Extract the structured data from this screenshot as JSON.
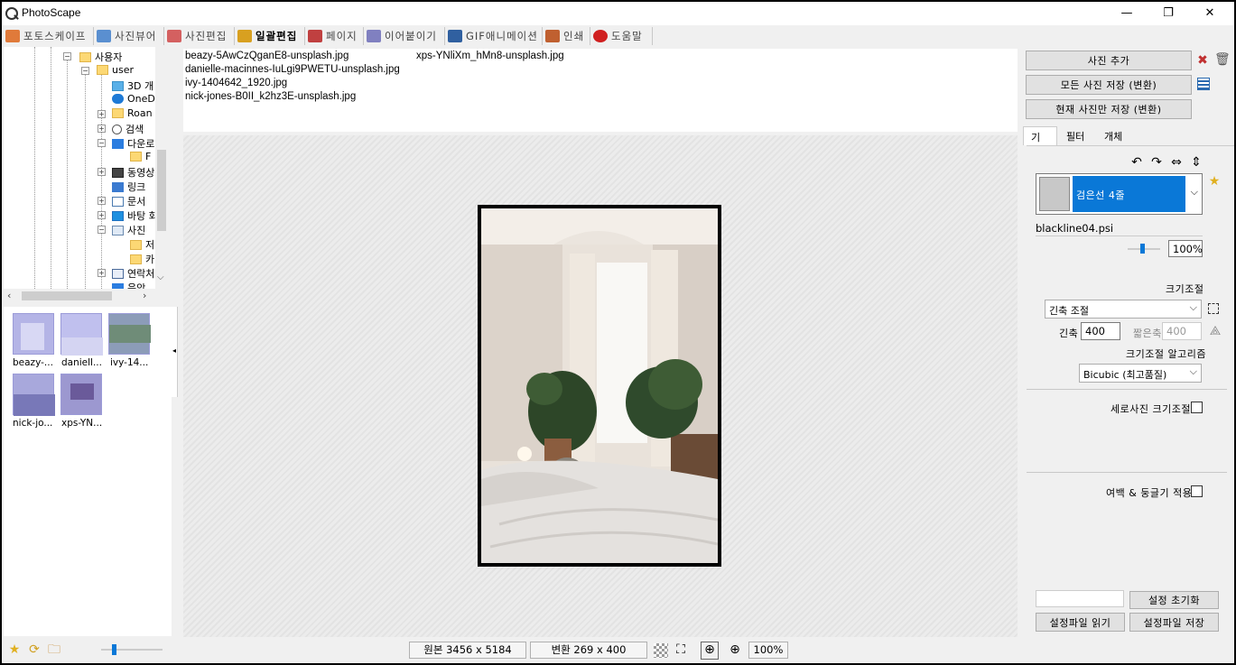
{
  "window": {
    "title": "PhotoScape",
    "minimize": "—",
    "maximize": "❐",
    "close": "✕"
  },
  "tabs": [
    {
      "label": "포토스케이프",
      "color": "#e07a3a"
    },
    {
      "label": "사진뷰어",
      "color": "#5a8fd0"
    },
    {
      "label": "사진편집",
      "color": "#d46060"
    },
    {
      "label": "일괄편집",
      "color": "#d8a020"
    },
    {
      "label": "페이지",
      "color": "#c04040"
    },
    {
      "label": "이어붙이기",
      "color": "#8080c0"
    },
    {
      "label": "GIF애니메이션",
      "color": "#3060a0"
    },
    {
      "label": "인쇄",
      "color": "#c06030"
    },
    {
      "label": "도움말",
      "color": "#d02020"
    }
  ],
  "tree": {
    "items": [
      {
        "label": "사용자"
      },
      {
        "label": "user"
      },
      {
        "label": "3D 개"
      },
      {
        "label": "OneD"
      },
      {
        "label": "Roan"
      },
      {
        "label": "검색"
      },
      {
        "label": "다운로"
      },
      {
        "label": "F"
      },
      {
        "label": "동영상"
      },
      {
        "label": "링크"
      },
      {
        "label": "문서"
      },
      {
        "label": "바탕 화"
      },
      {
        "label": "사진"
      },
      {
        "label": "저"
      },
      {
        "label": "카"
      },
      {
        "label": "연락처"
      },
      {
        "label": "음악"
      }
    ]
  },
  "thumbnails": [
    {
      "label": "beazy-...",
      "color": "#b4b4e6"
    },
    {
      "label": "daniell...",
      "color": "#c0c0ee"
    },
    {
      "label": "ivy-14...",
      "color": "#8c9cb8"
    },
    {
      "label": "nick-jo...",
      "color": "#a8a8dc"
    },
    {
      "label": "xps-YN...",
      "color": "#9c98d0"
    }
  ],
  "files": {
    "col1": [
      "beazy-5AwCzQganE8-unsplash.jpg",
      "danielle-macinnes-IuLgi9PWETU-unsplash.jpg",
      "ivy-1404642_1920.jpg",
      "nick-jones-B0II_k2hz3E-unsplash.jpg"
    ],
    "col2": [
      "xps-YNliXm_hMn8-unsplash.jpg"
    ]
  },
  "right": {
    "add_photo": "사진 추가",
    "save_all": "모든 사진 저장 (변환)",
    "save_current": "현재 사진만 저장 (변환)",
    "tabs": [
      "기본",
      "필터",
      "개체"
    ],
    "frame_name": "검은선 4줄",
    "frame_file": "blackline04.psi",
    "frame_zoom": "100%",
    "resize_title": "크기조절",
    "resize_mode": "긴축 조절",
    "long_axis_label": "긴축",
    "long_axis_value": "400",
    "short_axis_label": "짧은축",
    "short_axis_value": "400",
    "algorithm_label": "크기조절 알고리즘",
    "algorithm_value": "Bicubic (최고품질)",
    "portrait_resize": "세로사진 크기조절",
    "margin_round": "여백 & 둥글기 적용",
    "reset_settings": "설정 초기화",
    "load_settings": "설정파일 읽기",
    "save_settings": "설정파일 저장"
  },
  "status": {
    "original": "원본 3456 x 5184",
    "converted": "변환 269 x 400",
    "zoom": "100%"
  }
}
